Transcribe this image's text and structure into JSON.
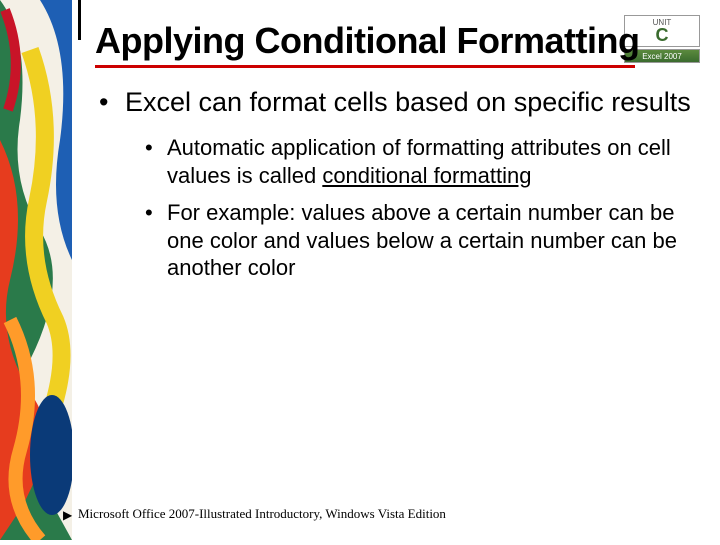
{
  "badge": {
    "unit_label": "UNIT",
    "unit_letter": "C",
    "excel_label": "Excel 2007"
  },
  "title": "Applying Conditional Formatting",
  "bullets": {
    "lvl1_0": "Excel can format cells based on specific results",
    "lvl2_0_pre": "Automatic application of formatting attributes on cell values is called ",
    "lvl2_0_term": "conditional formatting",
    "lvl2_1": "For example: values above a certain number can be one color and values below a certain number can be another color"
  },
  "footer": "Microsoft Office 2007-Illustrated Introductory, Windows Vista Edition"
}
